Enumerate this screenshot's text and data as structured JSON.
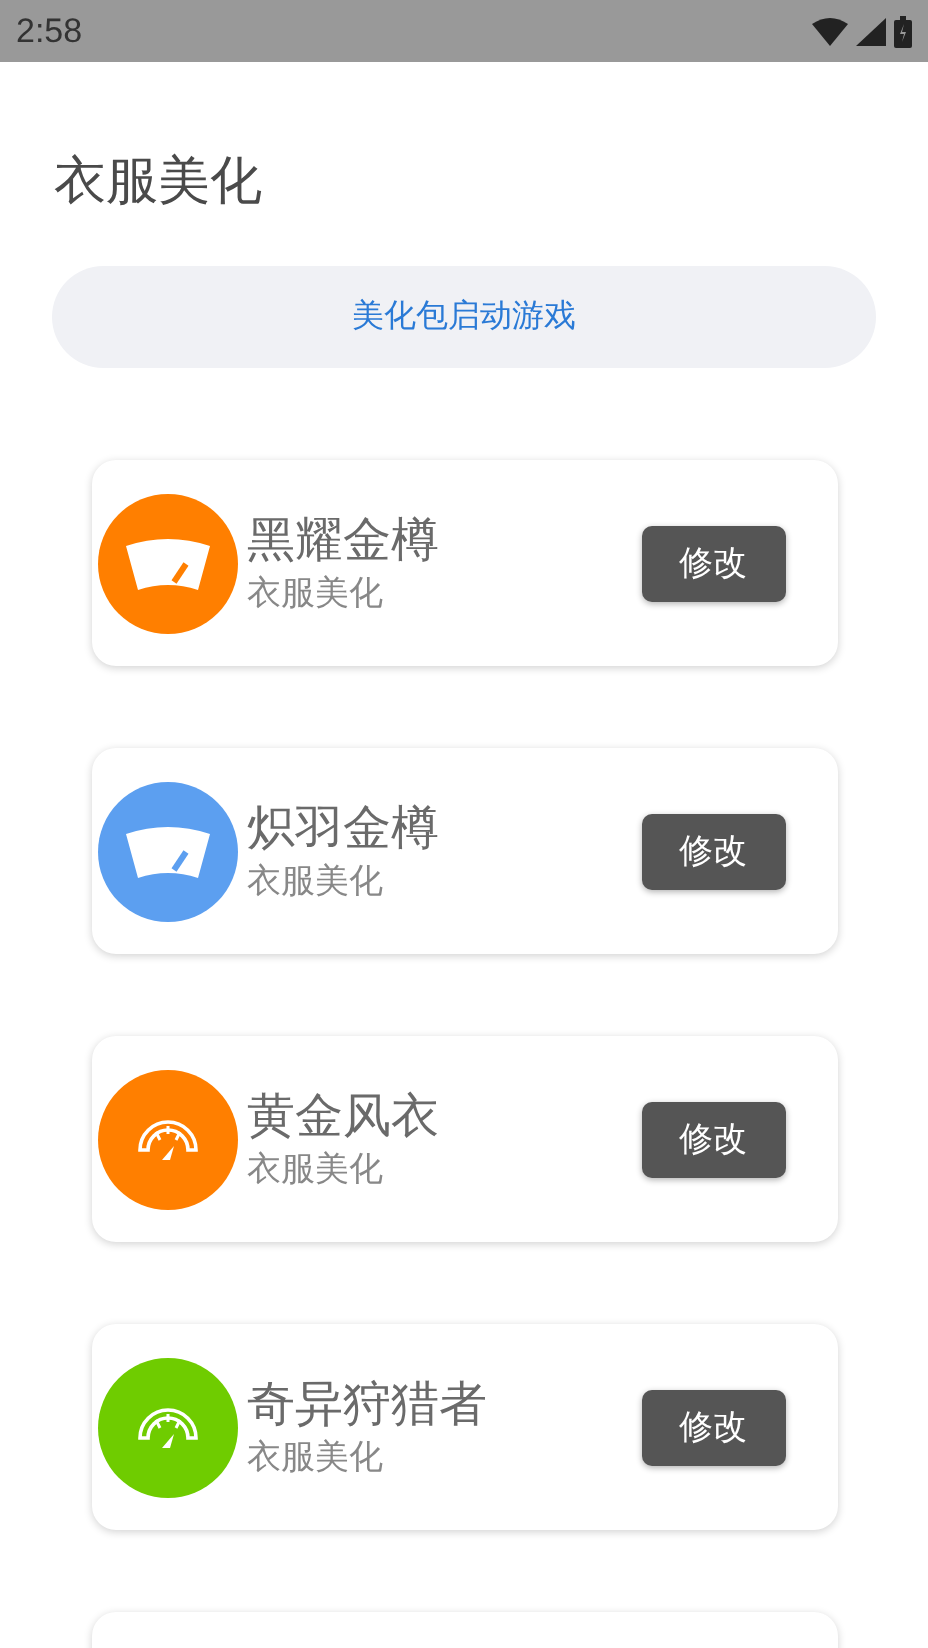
{
  "status_bar": {
    "time": "2:58"
  },
  "title": "衣服美化",
  "launch_button": "美化包启动游戏",
  "items": [
    {
      "name": "黑耀金樽",
      "subtitle": "衣服美化",
      "kind": "wiper",
      "color": "#ff7f00",
      "button": "修改"
    },
    {
      "name": "炽羽金樽",
      "subtitle": "衣服美化",
      "kind": "wiper",
      "color": "#5c9ff0",
      "button": "修改"
    },
    {
      "name": "黄金风衣",
      "subtitle": "衣服美化",
      "kind": "gauge",
      "color": "#ff7f00",
      "button": "修改"
    },
    {
      "name": "奇异狩猎者",
      "subtitle": "衣服美化",
      "kind": "gauge",
      "color": "#6fcc00",
      "button": "修改"
    }
  ]
}
